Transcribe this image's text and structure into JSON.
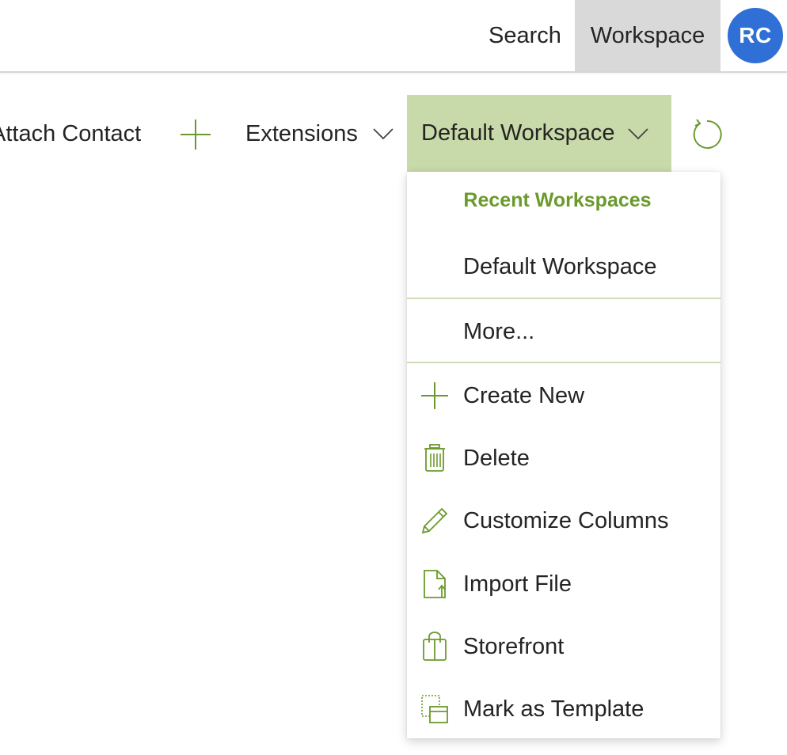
{
  "topbar": {
    "search_label": "Search",
    "workspace_label": "Workspace",
    "avatar_initials": "RC"
  },
  "commandbar": {
    "attach_contact_label": "Attach Contact",
    "extensions_label": "Extensions",
    "workspace_selector_label": "Default Workspace"
  },
  "dropdown": {
    "header": "Recent Workspaces",
    "recent_items": [
      "Default Workspace"
    ],
    "more_label": "More...",
    "actions": [
      {
        "label": "Create New",
        "icon": "plus-icon"
      },
      {
        "label": "Delete",
        "icon": "trash-icon"
      },
      {
        "label": "Customize Columns",
        "icon": "pencil-icon"
      },
      {
        "label": "Import File",
        "icon": "file-import-icon"
      },
      {
        "label": "Storefront",
        "icon": "shopping-bag-icon"
      },
      {
        "label": "Mark as Template",
        "icon": "template-icon"
      }
    ]
  },
  "colors": {
    "accent_green": "#6b9a2c",
    "selected_bg": "#c8d9aa",
    "avatar_blue": "#2f6fd6",
    "workspace_tab_bg": "#d9d9d9"
  }
}
